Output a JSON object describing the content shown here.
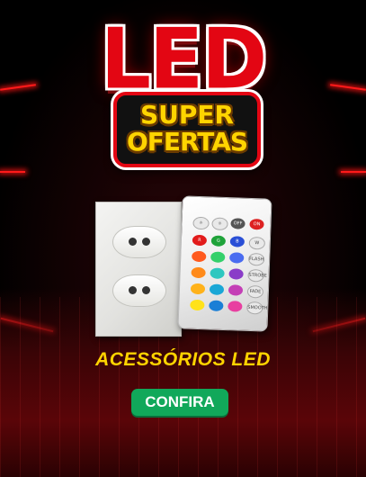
{
  "hero": {
    "logo_text": "LED",
    "badge_line1": "SUPER",
    "badge_line2": "OFERTAS"
  },
  "product": {
    "category_title": "ACESSÓRIOS LED",
    "items": [
      "socket-plate",
      "rgb-remote"
    ]
  },
  "remote": {
    "top_buttons": [
      "",
      "",
      "OFF",
      "ON"
    ],
    "row_buttons": [
      "R",
      "G",
      "B",
      "W"
    ],
    "side_labels": [
      "FLASH",
      "STROBE",
      "FADE",
      "SMOOTH"
    ]
  },
  "cta": {
    "label": "CONFIRA"
  },
  "colors": {
    "accent_red": "#e30613",
    "badge_yellow": "#ffd400",
    "cta_green": "#11a85a"
  }
}
